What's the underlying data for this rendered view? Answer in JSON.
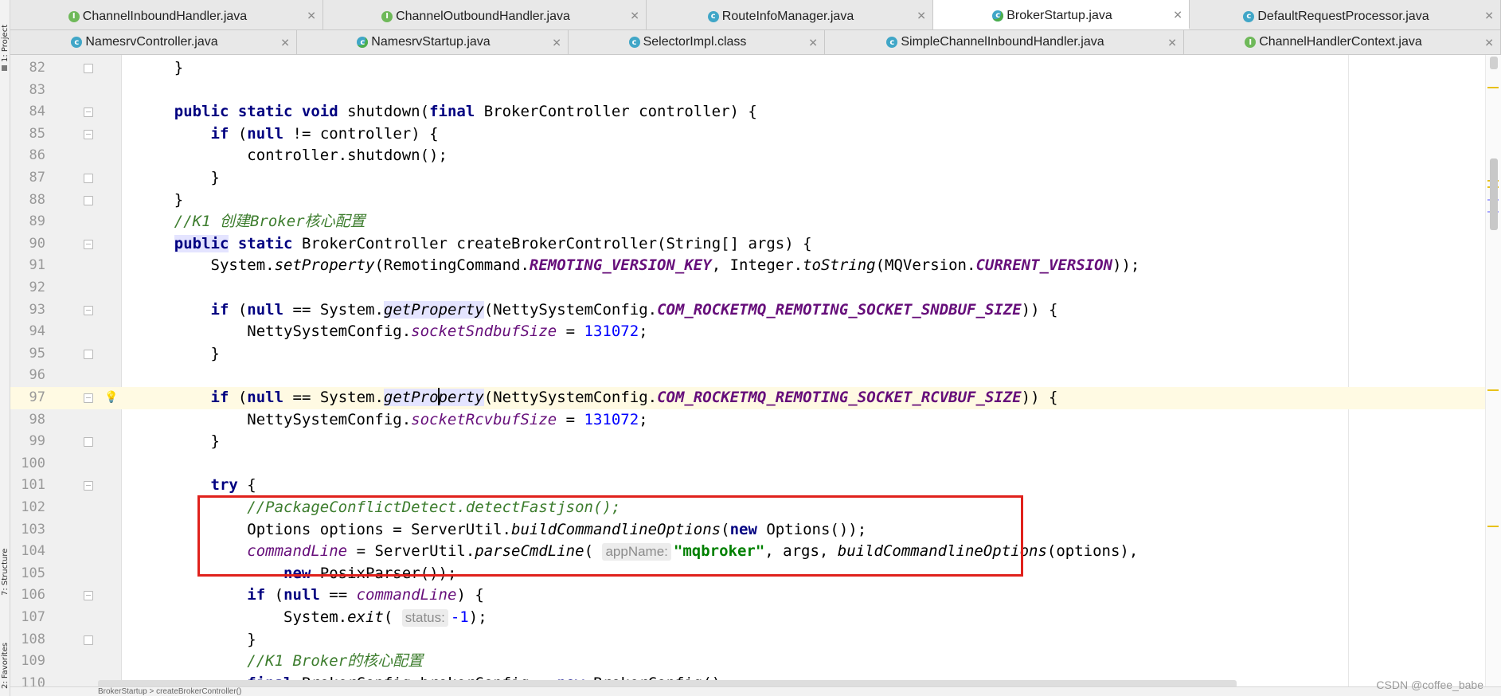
{
  "tool_strip": {
    "project": "1: Project",
    "structure": "7: Structure",
    "favorites": "2: Favorites"
  },
  "tabs_row1": [
    {
      "label": "ChannelInboundHandler.java",
      "icon": "interface-icon",
      "active": false
    },
    {
      "label": "ChannelOutboundHandler.java",
      "icon": "interface-icon",
      "active": false
    },
    {
      "label": "RouteInfoManager.java",
      "icon": "class-icon",
      "active": false
    },
    {
      "label": "BrokerStartup.java",
      "icon": "main-class-icon",
      "active": true
    },
    {
      "label": "DefaultRequestProcessor.java",
      "icon": "class-icon",
      "active": false
    }
  ],
  "tabs_row2": [
    {
      "label": "NamesrvController.java",
      "icon": "class-icon"
    },
    {
      "label": "NamesrvStartup.java",
      "icon": "main-class-icon"
    },
    {
      "label": "SelectorImpl.class",
      "icon": "class-icon"
    },
    {
      "label": "SimpleChannelInboundHandler.java",
      "icon": "class-icon"
    },
    {
      "label": "ChannelHandlerContext.java",
      "icon": "interface-icon"
    }
  ],
  "editor": {
    "current_line": 97,
    "hints": {
      "app_name": "appName:",
      "status": "status:"
    },
    "line_numbers": [
      "82",
      "83",
      "84",
      "85",
      "86",
      "87",
      "88",
      "89",
      "90",
      "91",
      "92",
      "93",
      "94",
      "95",
      "96",
      "97",
      "98",
      "99",
      "100",
      "101",
      "102",
      "103",
      "104",
      "105",
      "106",
      "107",
      "108",
      "109",
      "110"
    ]
  },
  "breadcrumb": "BrokerStartup  >  createBrokerController()",
  "watermark": "CSDN @coffee_babe",
  "colors": {
    "keyword": "#000080",
    "string": "#008000",
    "number": "#0000ff",
    "comment": "#3d7d2e",
    "static_field": "#660e7a",
    "highlight_box": "#e0211c",
    "current_line": "#fffae3"
  }
}
